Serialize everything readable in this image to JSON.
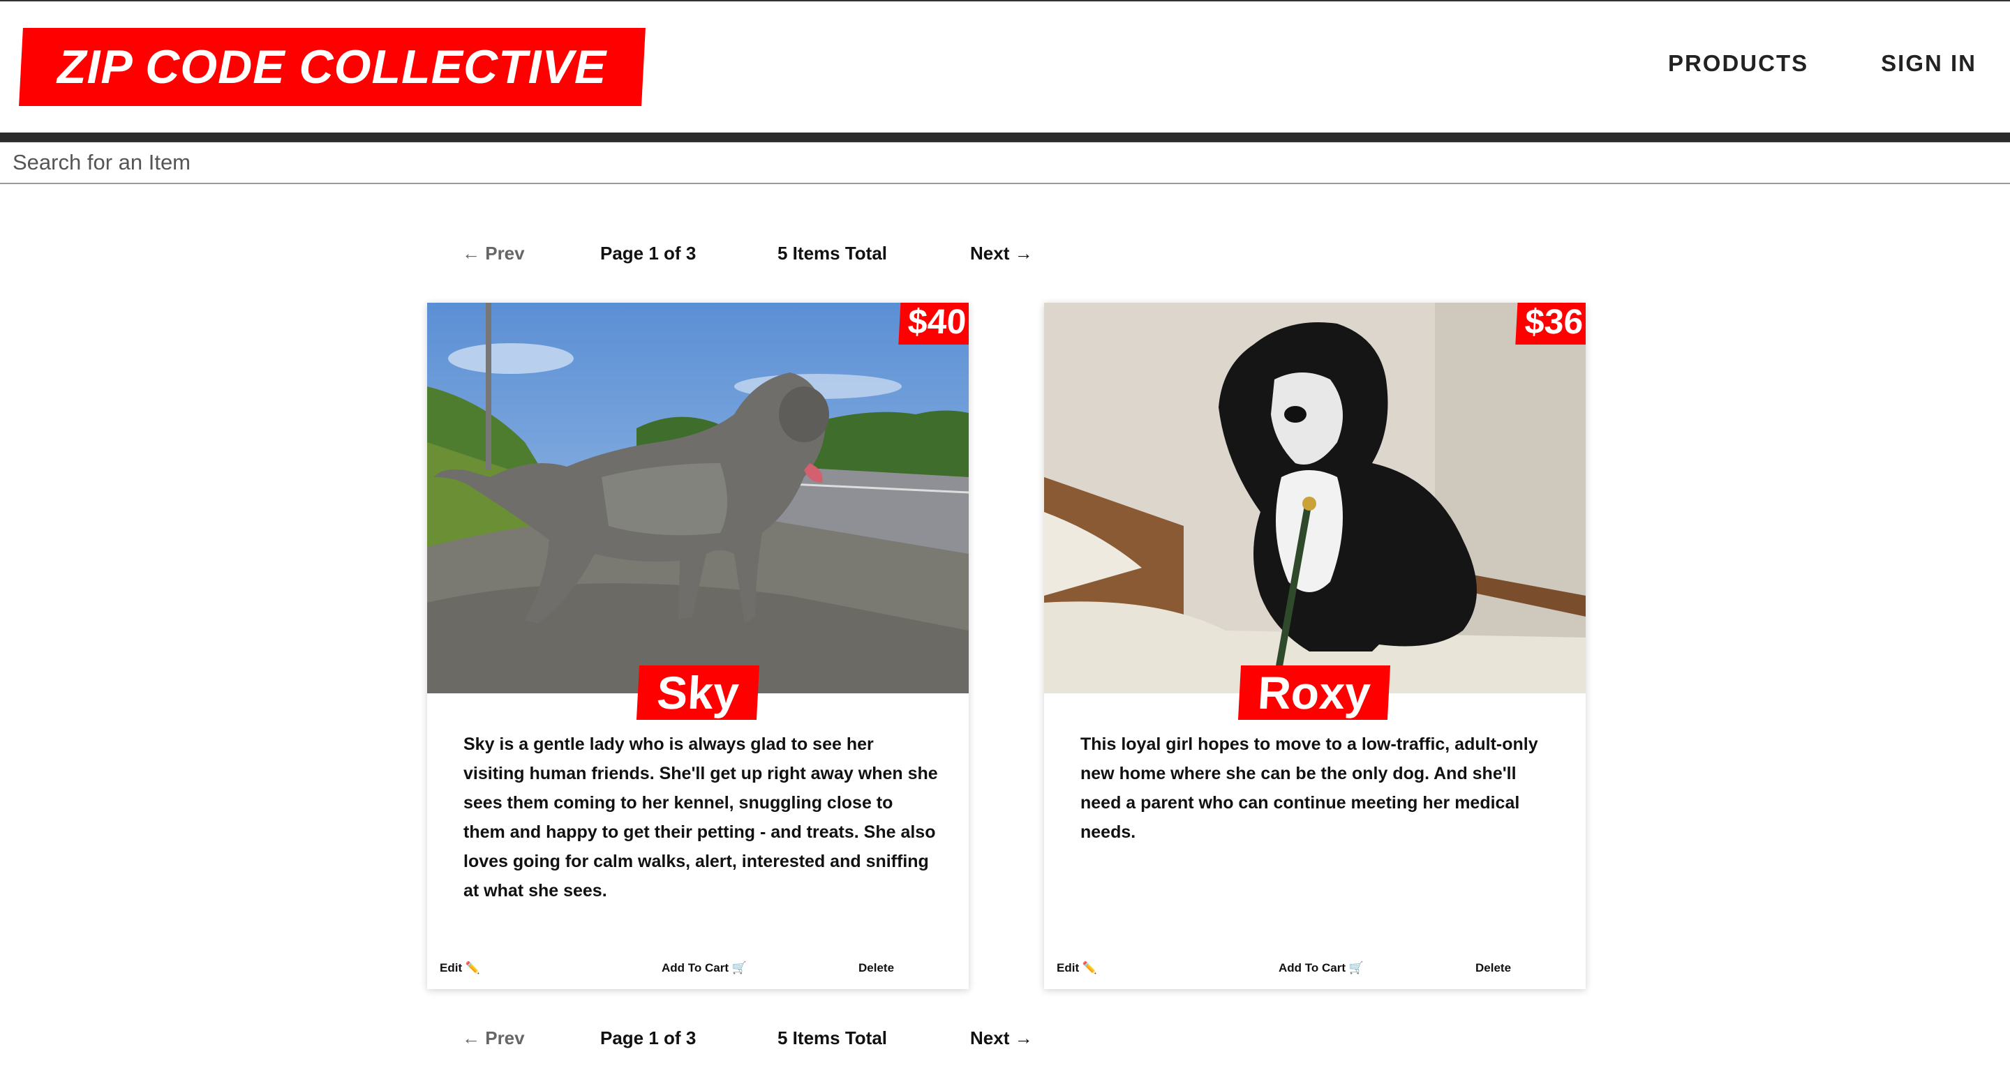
{
  "header": {
    "logo_text": "ZIP CODE COLLECTIVE",
    "nav": [
      "PRODUCTS",
      "SIGN IN"
    ]
  },
  "search": {
    "placeholder": "Search for an Item"
  },
  "pagination": {
    "prev": "← Prev",
    "page": "Page 1 of 3",
    "total": "5 Items Total",
    "next": "Next →"
  },
  "products": [
    {
      "name": "Sky",
      "price": "$40",
      "description": "Sky is a gentle lady who is always glad to see her visiting human friends. She'll get up right away when she sees them coming to her kennel, snuggling close to them and happy to get their petting - and treats. She also loves going for calm walks, alert, interested and sniffing at what she sees.",
      "actions": {
        "edit": "Edit ✏️",
        "cart": "Add To Cart 🛒",
        "delete": "Delete"
      }
    },
    {
      "name": "Roxy",
      "price": "$36",
      "description": "This loyal girl hopes to move to a low-traffic, adult-only new home where she can be the only dog. And she'll need a parent who can continue meeting her medical needs.",
      "actions": {
        "edit": "Edit ✏️",
        "cart": "Add To Cart 🛒",
        "delete": "Delete"
      }
    }
  ],
  "colors": {
    "brand_red": "#ff0000",
    "header_bar": "#2b2b2b"
  }
}
